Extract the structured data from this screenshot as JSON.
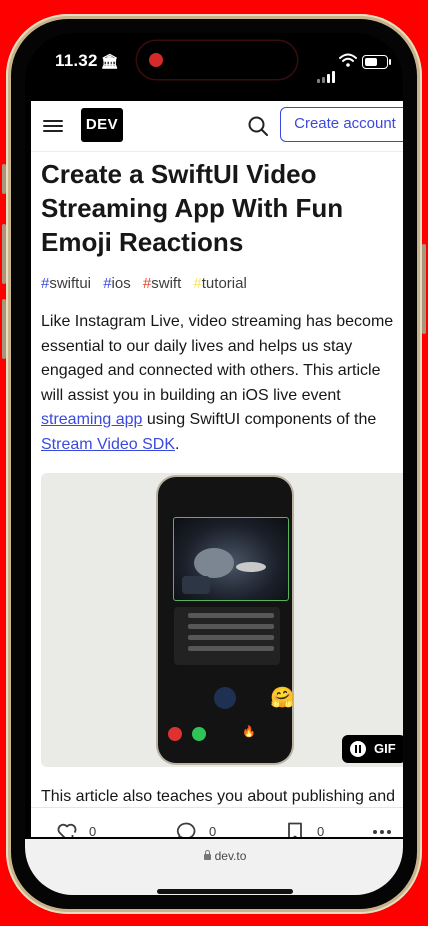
{
  "status_bar": {
    "time": "11.32",
    "bank_icon": "🏛"
  },
  "header": {
    "logo": "DEV",
    "create_account": "Create account"
  },
  "article": {
    "title": "Create a SwiftUI Video Streaming App With Fun Emoji Reactions",
    "tags": [
      {
        "hash": "#",
        "name": "swiftui",
        "color": "#3b49df"
      },
      {
        "hash": "#",
        "name": "ios",
        "color": "#3b49df"
      },
      {
        "hash": "#",
        "name": "swift",
        "color": "#e0452f"
      },
      {
        "hash": "#",
        "name": "tutorial",
        "color": "#fae45a"
      }
    ],
    "intro_1": "Like Instagram Live, video streaming has become essential to our daily lives and helps us stay engaged and connected with others. This article will assist you in building an iOS live event ",
    "link_1": "streaming app",
    "intro_2": " using SwiftUI components of the ",
    "link_2": "Stream Video SDK",
    "intro_3": ".",
    "gif_label": "GIF",
    "para_2": "This article also teaches you about publishing and"
  },
  "actions": {
    "reactions_count": "0",
    "comments_count": "0",
    "bookmarks_count": "0"
  },
  "browser": {
    "url": "dev.to"
  },
  "colors": {
    "accent": "#3b49df",
    "background": "#ff0000"
  }
}
